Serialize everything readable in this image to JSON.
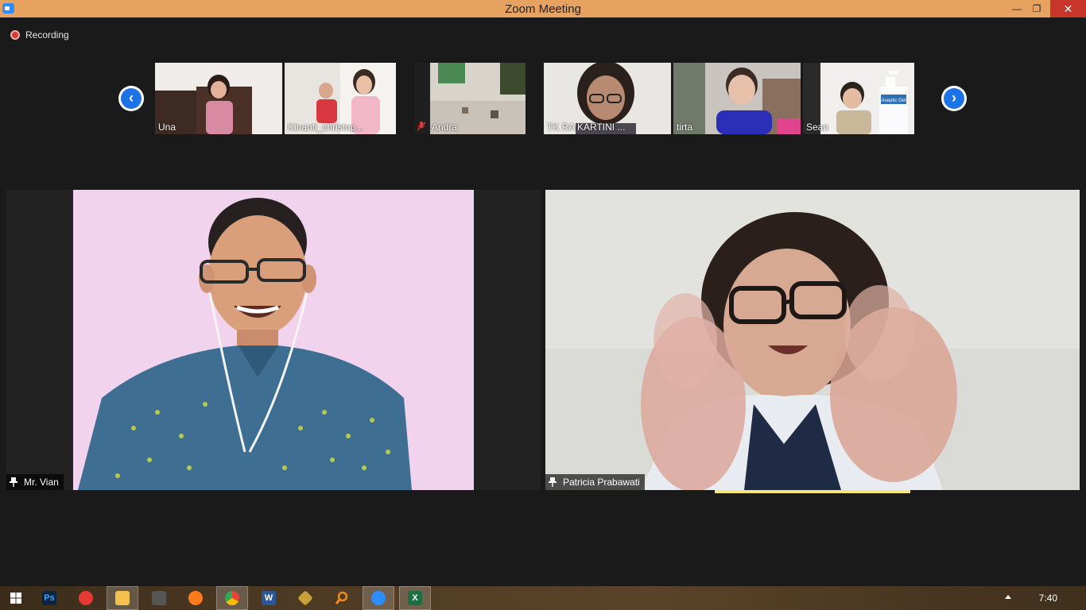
{
  "window": {
    "title": "Zoom Meeting",
    "minimize_glyph": "—",
    "restore_glyph": "❐",
    "close_glyph": "✕"
  },
  "recording": {
    "label": "Recording"
  },
  "strip": {
    "prev_glyph": "‹",
    "next_glyph": "›",
    "participants": [
      {
        "name": "Una",
        "muted": false
      },
      {
        "name": "Kinanti_christop...",
        "muted": false
      },
      {
        "name": "Andra",
        "muted": true
      },
      {
        "name": "TK RA KARTINI ...",
        "muted": false
      },
      {
        "name": "tirta",
        "muted": false
      },
      {
        "name": "Sean",
        "muted": false
      }
    ],
    "bottle_label": "Aseptic Gel"
  },
  "main": {
    "left": {
      "name": "Mr. Vian",
      "pinned": true
    },
    "right": {
      "name": "Patricia Prabawati",
      "pinned": true,
      "active_speaker": true
    }
  },
  "taskbar": {
    "items": [
      "windows-start",
      "photoshop",
      "screen-recorder",
      "file-explorer",
      "media-player",
      "firefox",
      "chrome",
      "word",
      "tool",
      "search",
      "zoom",
      "excel"
    ],
    "ps_glyph": "Ps",
    "word_glyph": "W",
    "excel_glyph": "X",
    "clock": "7:40"
  },
  "colors": {
    "titlebar": "#e8a25f",
    "close_button": "#c7352b",
    "accent_blue": "#1c73e8",
    "speaker_highlight": "#f7e77a",
    "meeting_bg": "#1a1a1a"
  }
}
